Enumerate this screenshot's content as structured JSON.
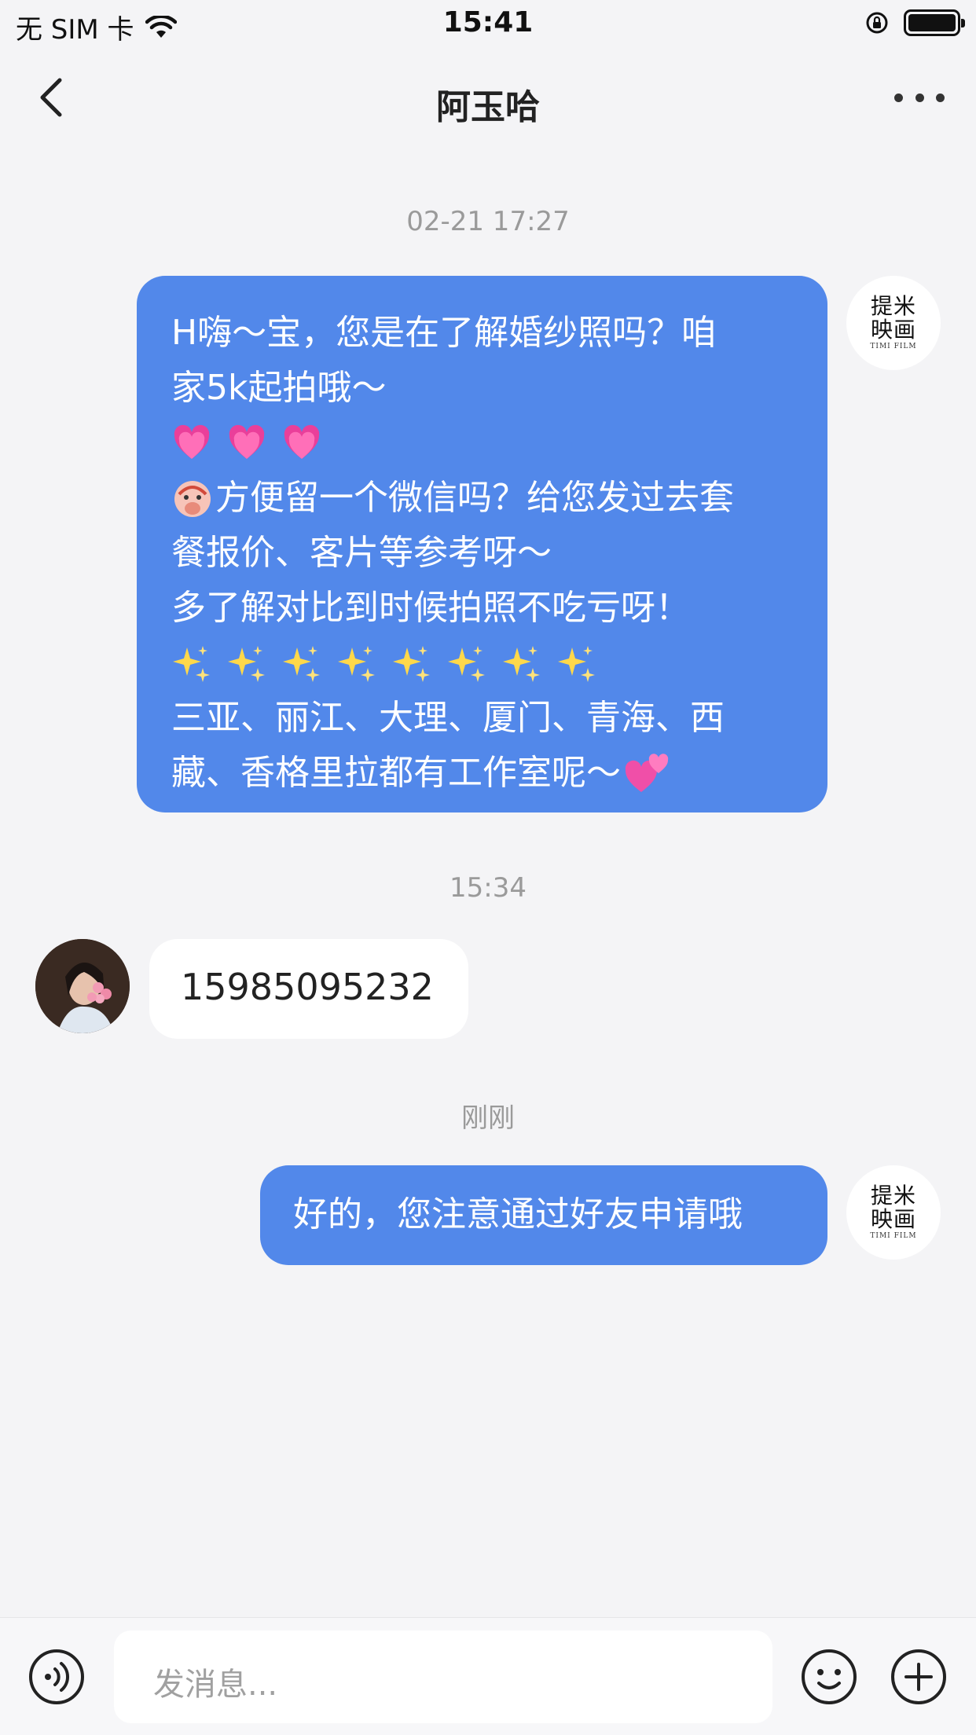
{
  "status_bar": {
    "carrier": "无 SIM 卡",
    "time": "15:41"
  },
  "nav": {
    "title": "阿玉哈",
    "back_icon": "chevron-left-icon",
    "more_icon": "more-dots-icon"
  },
  "messages": {
    "ts1": "02-21 17:27",
    "msg1": {
      "lines": [
        "H嗨～宝，您是在了解婚纱照吗？咱",
        "家5k起拍哦～",
        "方便留一个微信吗？给您发过去套",
        "餐报价、客片等参考呀～",
        "多了解对比到时候拍照不吃亏呀！",
        "三亚、丽江、大理、厦门、青海、西",
        "藏、香格里拉都有工作室呢～"
      ]
    },
    "ts2": "15:34",
    "msg2": "15985095232",
    "ts3": "刚刚",
    "msg3": "好的，您注意通过好友申请哦"
  },
  "brand_avatar": {
    "line1": "提米",
    "line2": "映画",
    "sub": "TIMI FILM"
  },
  "composer": {
    "placeholder": "发消息...",
    "voice_icon": "voice-icon",
    "emoji_icon": "emoji-icon",
    "plus_icon": "plus-icon"
  },
  "colors": {
    "bubble_out": "#5288ea",
    "bubble_in": "#ffffff",
    "background": "#f4f4f6"
  }
}
